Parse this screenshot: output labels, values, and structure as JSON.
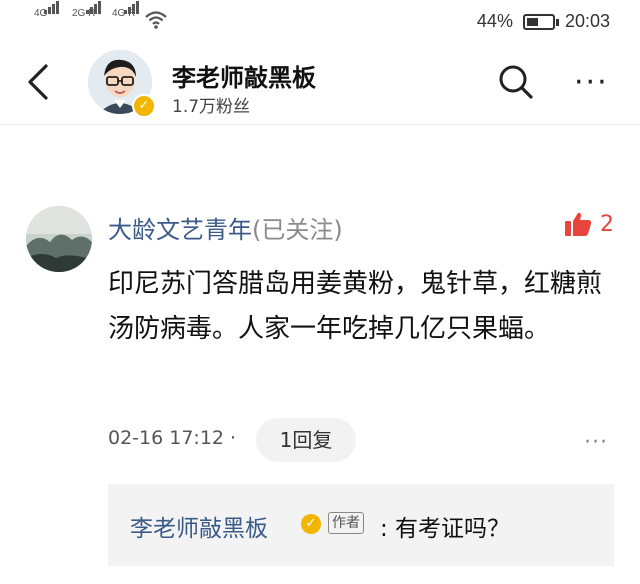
{
  "status_bar": {
    "signal_1": "4G",
    "signal_2": "2G R",
    "signal_3": "4G R",
    "battery": "44%",
    "battery_level": 0.44,
    "time": "20:03"
  },
  "header": {
    "account_name": "李老师敲黑板",
    "followers": "1.7万粉丝"
  },
  "comment": {
    "author": "大龄文艺青年",
    "follow_status": "(已关注)",
    "likes": "2",
    "body": "印尼苏门答腊岛用姜黄粉，鬼针草，红糖煎汤防病毒。人家一年吃掉几亿只果蝠。",
    "timestamp": "02-16 17:12 ·",
    "reply_count": "1回复"
  },
  "reply": {
    "author": "李老师敲黑板",
    "author_tag": "作者",
    "text": ": 有考证吗？"
  },
  "colors": {
    "link_blue": "#3a5a88",
    "like_red": "#e8463c",
    "badge_gold": "#f2b500"
  }
}
